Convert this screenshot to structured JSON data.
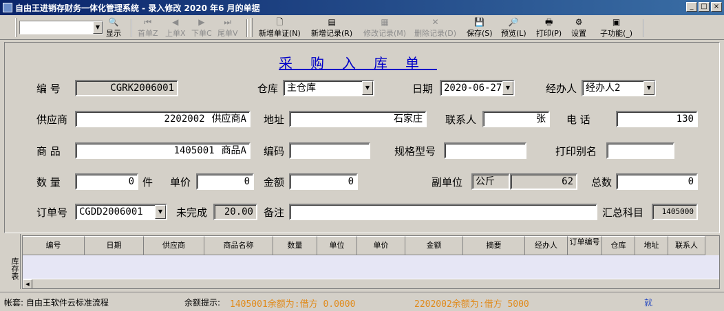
{
  "window": {
    "title": "自由王进销存财务一体化管理系统 - 录入修改 2020 年6 月的单据"
  },
  "toolbar": {
    "show": "显示",
    "first": "首单Z",
    "prev": "上单X",
    "next": "下单C",
    "last": "尾单V",
    "new_voucher": "新增单证(N)",
    "new_record": "新增记录(R)",
    "edit_record": "修改记录(M)",
    "delete_record": "删除记录(D)",
    "save": "保存(S)",
    "preview": "预览(L)",
    "print": "打印(P)",
    "settings": "设置",
    "subfunc": "子功能(_)"
  },
  "form": {
    "title": "采购入库单",
    "labels": {
      "code": "编  号",
      "warehouse": "仓库",
      "date": "日期",
      "handler": "经办人",
      "supplier": "供应商",
      "address": "地址",
      "contact": "联系人",
      "phone": "电  话",
      "goods": "商  品",
      "goods_code": "编码",
      "spec": "规格型号",
      "print_alias": "打印别名",
      "qty": "数  量",
      "unit": "件",
      "price": "单价",
      "amount": "金额",
      "sub_unit": "副单位",
      "total": "总数",
      "order_no": "订单号",
      "unfinished": "未完成",
      "note": "备注",
      "summary_account": "汇总科目"
    },
    "values": {
      "code": "CGRK2006001",
      "warehouse": "主仓库",
      "date": "2020-06-27",
      "handler": "经办人2",
      "supplier_code": "2202002",
      "supplier_name": "供应商A",
      "address": "石家庄",
      "contact": "张",
      "phone": "130",
      "goods_code_main": "1405001",
      "goods_name": "商品A",
      "goods_code": "",
      "spec": "",
      "print_alias": "",
      "qty": "0",
      "price": "0",
      "amount": "0",
      "sub_unit_name": "公斤",
      "sub_unit_value": "62",
      "total": "0",
      "order_no": "CGDD2006001",
      "unfinished": "20.00",
      "note": "",
      "summary_account": "1405000"
    }
  },
  "grid": {
    "side_tab": "库存表",
    "columns": [
      "编号",
      "日期",
      "供应商",
      "商品名称",
      "数量",
      "单位",
      "单价",
      "金额",
      "摘要",
      "经办人",
      "订单编号",
      "仓库",
      "地址",
      "联系人"
    ]
  },
  "status": {
    "account": "帐套: 自由王软件云标准流程",
    "balance_label": "余额提示:",
    "balance1": "1405001余额为:借方 0.0000",
    "balance2": "2202002余额为:借方 5000",
    "link": "就"
  },
  "colors": {
    "title_bar": "#0a246a",
    "form_title": "#0000c8",
    "balance_text": "#e08a1a",
    "grid_bg": "#e6e6f5"
  }
}
